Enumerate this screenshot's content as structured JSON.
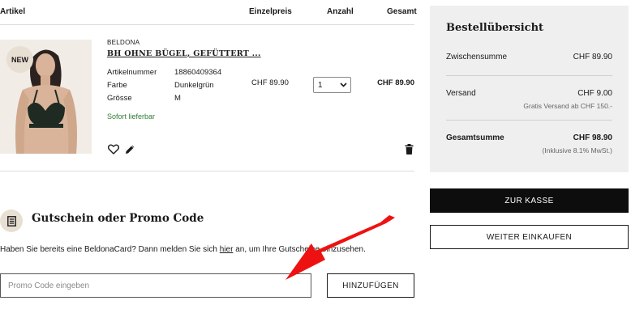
{
  "table_header": {
    "article": "Artikel",
    "unit_price": "Einzelpreis",
    "quantity": "Anzahl",
    "total": "Gesamt"
  },
  "cart_item": {
    "badge": "NEW",
    "brand": "BELDONA",
    "name": "BH OHNE BÜGEL, GEFÜTTERT ...",
    "attributes": [
      {
        "label": "Artikelnummer",
        "value": "18860409364"
      },
      {
        "label": "Farbe",
        "value": "Dunkelgrün"
      },
      {
        "label": "Grösse",
        "value": "M"
      }
    ],
    "stock_status": "Sofort lieferbar",
    "unit_price": "CHF 89.90",
    "quantity": "1",
    "total_price": "CHF 89.90",
    "icons": {
      "favorite": "heart-icon",
      "edit": "pencil-icon",
      "delete": "trash-icon"
    }
  },
  "promo": {
    "title": "Gutschein oder Promo Code",
    "text_before": "Haben Sie bereits eine BeldonaCard? Dann melden Sie sich ",
    "link": "hier",
    "text_after": " an, um Ihre Gutscheine einzusehen.",
    "input_placeholder": "Promo Code eingeben",
    "add_button": "HINZUFÜGEN",
    "icon": "receipt-icon"
  },
  "summary": {
    "title": "Bestellübersicht",
    "subtotal_label": "Zwischensumme",
    "subtotal_value": "CHF 89.90",
    "shipping_label": "Versand",
    "shipping_value": "CHF 9.00",
    "shipping_note": "Gratis Versand ab CHF 150.-",
    "total_label": "Gesamtsumme",
    "total_value": "CHF 98.90",
    "vat_note": "(Inklusive 8.1% MwSt.)",
    "checkout_button": "ZUR KASSE",
    "continue_button": "WEITER EINKAUFEN"
  },
  "colors": {
    "accent_dark": "#0d0d0d",
    "badge_bg": "#e8dfd3",
    "summary_bg": "#efefef",
    "stock_green": "#2e7d32",
    "annotation_arrow": "#ee1111"
  }
}
